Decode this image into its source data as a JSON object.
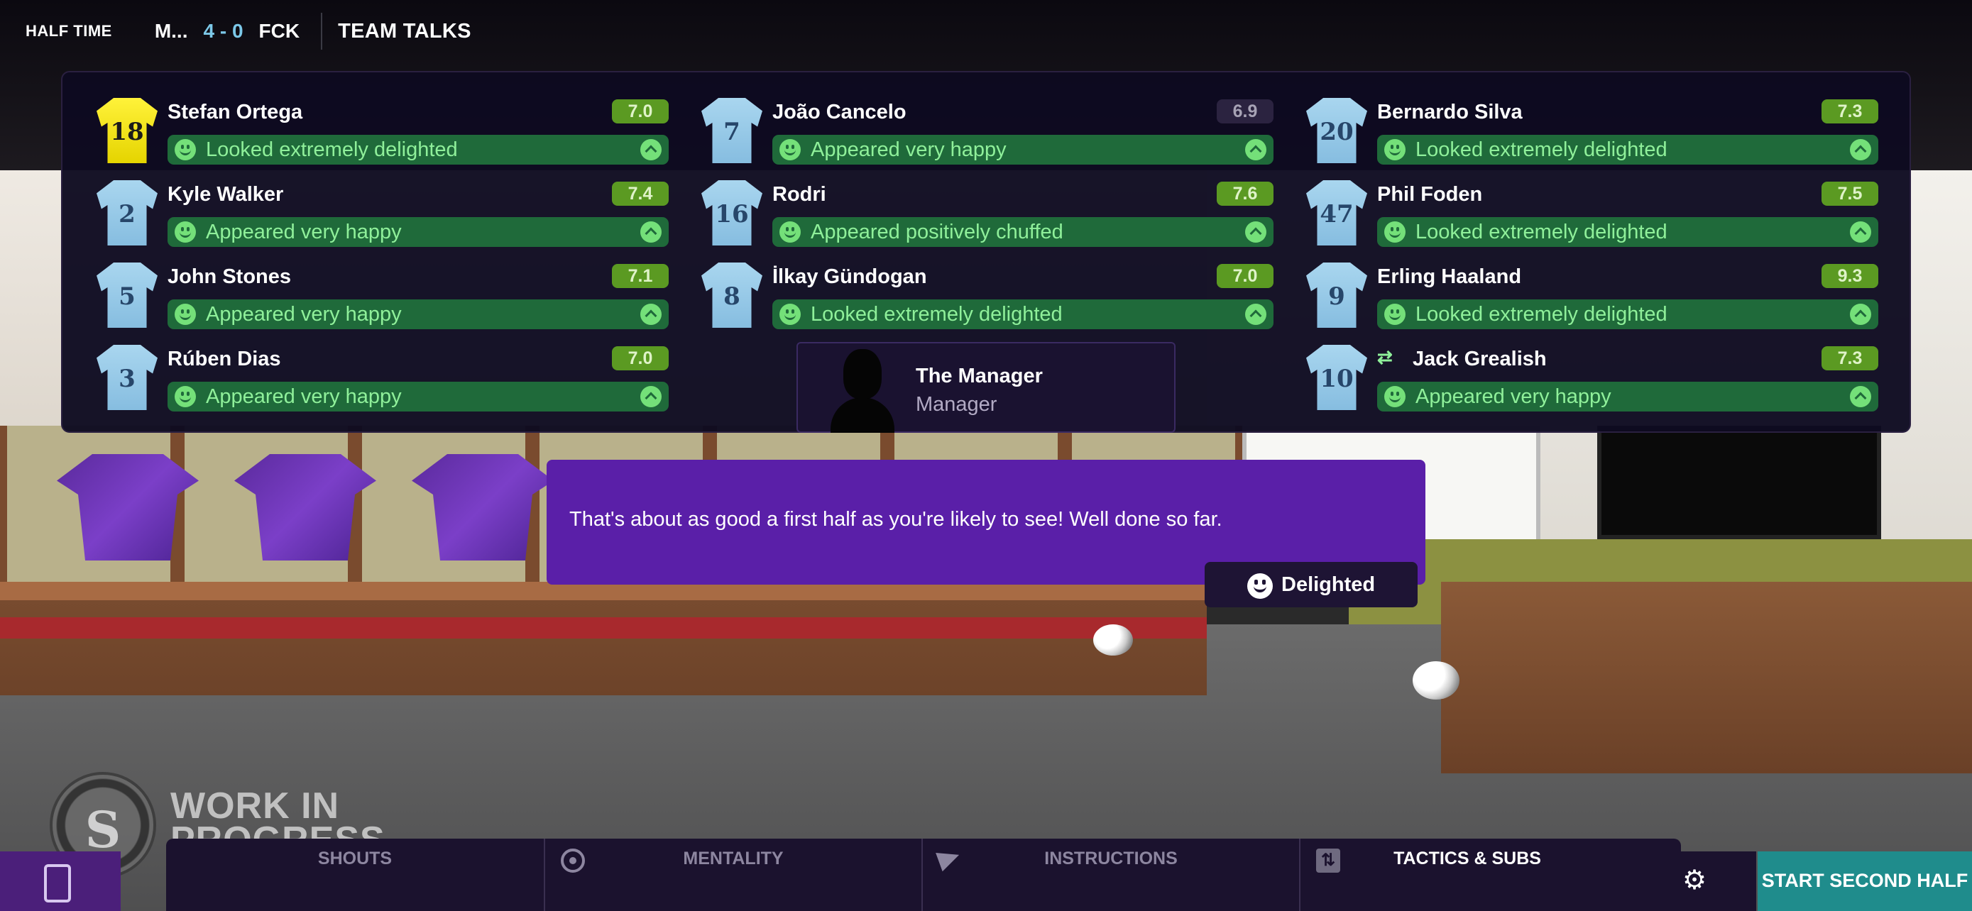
{
  "header": {
    "phase": "HALF TIME",
    "home_team": "M...",
    "score": "4 - 0",
    "away_team": "FCK",
    "section": "TEAM TALKS"
  },
  "players": [
    {
      "number": "18",
      "name": "Stefan Ortega",
      "rating": "7.0",
      "reaction": "Looked extremely delighted",
      "goalkeeper": true
    },
    {
      "number": "7",
      "name": "João Cancelo",
      "rating": "6.9",
      "reaction": "Appeared very happy"
    },
    {
      "number": "20",
      "name": "Bernardo Silva",
      "rating": "7.3",
      "reaction": "Looked extremely delighted"
    },
    {
      "number": "2",
      "name": "Kyle Walker",
      "rating": "7.4",
      "reaction": "Appeared very happy"
    },
    {
      "number": "16",
      "name": "Rodri",
      "rating": "7.6",
      "reaction": "Appeared positively chuffed"
    },
    {
      "number": "47",
      "name": "Phil Foden",
      "rating": "7.5",
      "reaction": "Looked extremely delighted"
    },
    {
      "number": "5",
      "name": "John Stones",
      "rating": "7.1",
      "reaction": "Appeared very happy"
    },
    {
      "number": "8",
      "name": "İlkay Gündogan",
      "rating": "7.0",
      "reaction": "Looked extremely delighted"
    },
    {
      "number": "9",
      "name": "Erling Haaland",
      "rating": "9.3",
      "reaction": "Looked extremely delighted"
    },
    {
      "number": "3",
      "name": "Rúben Dias",
      "rating": "7.0",
      "reaction": "Appeared very happy"
    },
    {
      "number": "10",
      "name": "Jack Grealish",
      "rating": "7.3",
      "reaction": "Appeared very happy",
      "swap_icon": "⇄"
    }
  ],
  "manager": {
    "name": "The Manager",
    "role": "Manager"
  },
  "speech": {
    "text": "That's about as good a first half as you're likely to see! Well done so far.",
    "tone": "Delighted"
  },
  "watermark": {
    "line1": "WORK IN",
    "line2": "PROGRESS",
    "logo_letter": "S"
  },
  "bottom": {
    "tabs": [
      "SHOUTS",
      "MENTALITY",
      "INSTRUCTIONS",
      "TACTICS & SUBS"
    ],
    "start_label": "START SECOND HALF",
    "settings_glyph": "⚙"
  },
  "colors": {
    "panel_bg": "#0e0a20",
    "rating_green": "#5b9a22",
    "reaction_green": "#1f6a3a",
    "speech_purple": "#5a1fa8",
    "start_teal": "#1f8c8c",
    "score_blue": "#7cc8e8"
  }
}
